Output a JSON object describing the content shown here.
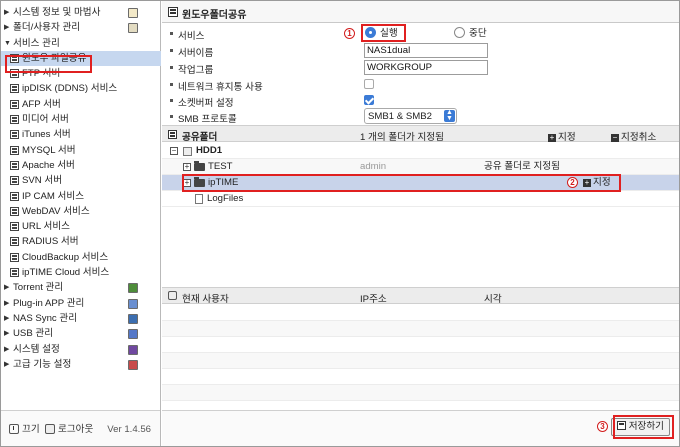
{
  "sidebar": {
    "items": [
      {
        "label": "시스템 정보 및 마법사",
        "icon": "system-info-icon"
      },
      {
        "label": "폴더/사용자 관리",
        "icon": "folder-user-icon"
      },
      {
        "label": "서비스 관리",
        "icon": "none"
      },
      {
        "label": "윈도우 파일공유"
      },
      {
        "label": "FTP 서버"
      },
      {
        "label": "ipDISK (DDNS) 서비스"
      },
      {
        "label": "AFP 서버"
      },
      {
        "label": "미디어 서버"
      },
      {
        "label": "iTunes 서버"
      },
      {
        "label": "MYSQL 서버"
      },
      {
        "label": "Apache 서버"
      },
      {
        "label": "SVN 서버"
      },
      {
        "label": "IP CAM 서비스"
      },
      {
        "label": "WebDAV 서비스"
      },
      {
        "label": "URL 서비스"
      },
      {
        "label": "RADIUS 서버"
      },
      {
        "label": "CloudBackup 서비스"
      },
      {
        "label": "ipTIME Cloud 서비스"
      },
      {
        "label": "Torrent 관리",
        "icon": "torrent-icon"
      },
      {
        "label": "Plug-in APP 관리",
        "icon": "plugin-icon"
      },
      {
        "label": "NAS Sync 관리",
        "icon": "nas-sync-icon"
      },
      {
        "label": "USB 관리",
        "icon": "usb-icon"
      },
      {
        "label": "시스템 설정",
        "icon": "settings-icon"
      },
      {
        "label": "고급 기능 설정",
        "icon": "advanced-icon"
      }
    ],
    "footer": {
      "power_label": "끄기",
      "logout_label": "로그아웃",
      "version": "Ver 1.4.56"
    }
  },
  "main": {
    "title": "윈도우폴더공유",
    "form": {
      "service_label": "서비스",
      "service_on": "실행",
      "service_off": "중단",
      "server_name_label": "서버이름",
      "server_name_value": "NAS1dual",
      "workgroup_label": "작업그룹",
      "workgroup_value": "WORKGROUP",
      "recycle_label": "네트워크 휴지통 사용",
      "socket_buffer_label": "소켓버퍼 설정",
      "smb_label": "SMB 프로토콜",
      "smb_value": "SMB1 & SMB2"
    },
    "share": {
      "header_label": "공유폴더",
      "count_text": "1 개의 폴더가 지정됨",
      "add_label": "지정",
      "remove_label": "지정취소",
      "rows": [
        {
          "name": "HDD1"
        },
        {
          "name": "TEST",
          "owner": "admin",
          "status": "공유 폴더로 지정됨"
        },
        {
          "name": "ipTIME",
          "action": "지정"
        },
        {
          "name": "LogFiles"
        }
      ]
    },
    "users": {
      "col_user": "현재 사용자",
      "col_ip": "IP주소",
      "col_time": "시각"
    },
    "save_label": "저장하기"
  },
  "markers": [
    "1",
    "2",
    "3"
  ],
  "colors": {
    "accent": "#3b7bd6",
    "highlight": "#e02020",
    "selected_row": "#c8d3ea"
  }
}
